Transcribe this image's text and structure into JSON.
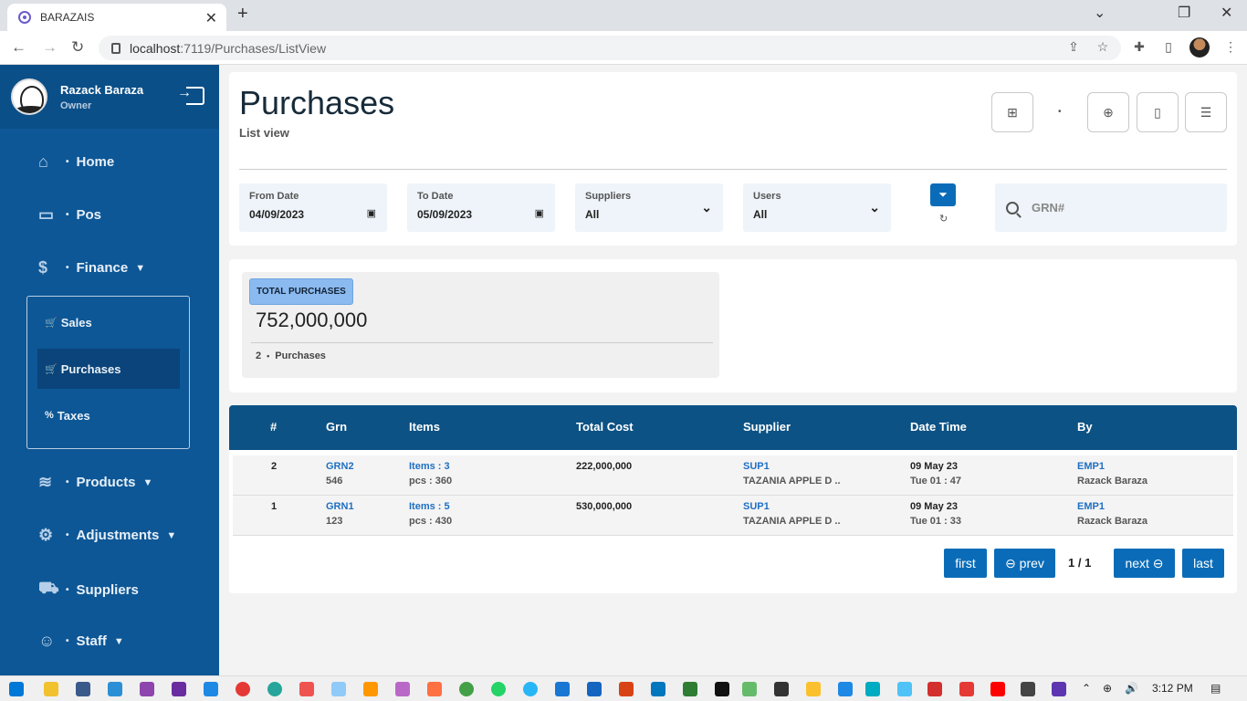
{
  "browser": {
    "tab_title": "BARAZAIS",
    "tab_close": "✕",
    "new_tab": "+",
    "url_host": "localhost",
    "url_path": ":7119/Purchases/ListView",
    "win_min": "⌄",
    "win_restore": "❐",
    "win_close": "✕"
  },
  "user": {
    "name": "Razack  Baraza",
    "role": "Owner"
  },
  "menu": {
    "home": "Home",
    "pos": "Pos",
    "finance": "Finance",
    "sales": "Sales",
    "purchases": "Purchases",
    "taxes": "Taxes",
    "products": "Products",
    "adjustments": "Adjustments",
    "suppliers": "Suppliers",
    "staff": "Staff"
  },
  "page": {
    "title": "Purchases",
    "subtitle": "List view"
  },
  "filters": {
    "from_label": "From Date",
    "from_value": "04/09/2023",
    "to_label": "To Date",
    "to_value": "05/09/2023",
    "suppliers_label": "Suppliers",
    "suppliers_value": "All",
    "users_label": "Users",
    "users_value": "All",
    "search_placeholder": "GRN#"
  },
  "summary": {
    "badge": "TOTAL PURCHASES",
    "total": "752,000,000",
    "count": "2",
    "count_label": "Purchases"
  },
  "table": {
    "headers": [
      "#",
      "Grn",
      "Items",
      "Total Cost",
      "Supplier",
      "Date Time",
      "By"
    ],
    "rows": [
      {
        "num": "2",
        "grn": "GRN2",
        "grn_sub": "546",
        "items": "Items : 3",
        "pcs": "pcs : 360",
        "cost": "222,000,000",
        "supplier": "SUP1",
        "supplier_name": "TAZANIA APPLE D ..",
        "date": "09 May 23",
        "time": "Tue 01 : 47",
        "by": "EMP1",
        "by_name": "Razack Baraza"
      },
      {
        "num": "1",
        "grn": "GRN1",
        "grn_sub": "123",
        "items": "Items : 5",
        "pcs": "pcs : 430",
        "cost": "530,000,000",
        "supplier": "SUP1",
        "supplier_name": "TAZANIA APPLE D ..",
        "date": "09 May 23",
        "time": "Tue 01 : 33",
        "by": "EMP1",
        "by_name": "Razack Baraza"
      }
    ]
  },
  "pagination": {
    "first": "first",
    "prev": "⊖ prev",
    "page": "1 / 1",
    "next": "next ⊖",
    "last": "last"
  },
  "taskbar": {
    "time": "3:12 PM"
  },
  "colors": {
    "sidebar": "#0d5796",
    "table_header": "#0d5284",
    "primary_button": "#0a6cb8",
    "link": "#1f6fc2"
  }
}
